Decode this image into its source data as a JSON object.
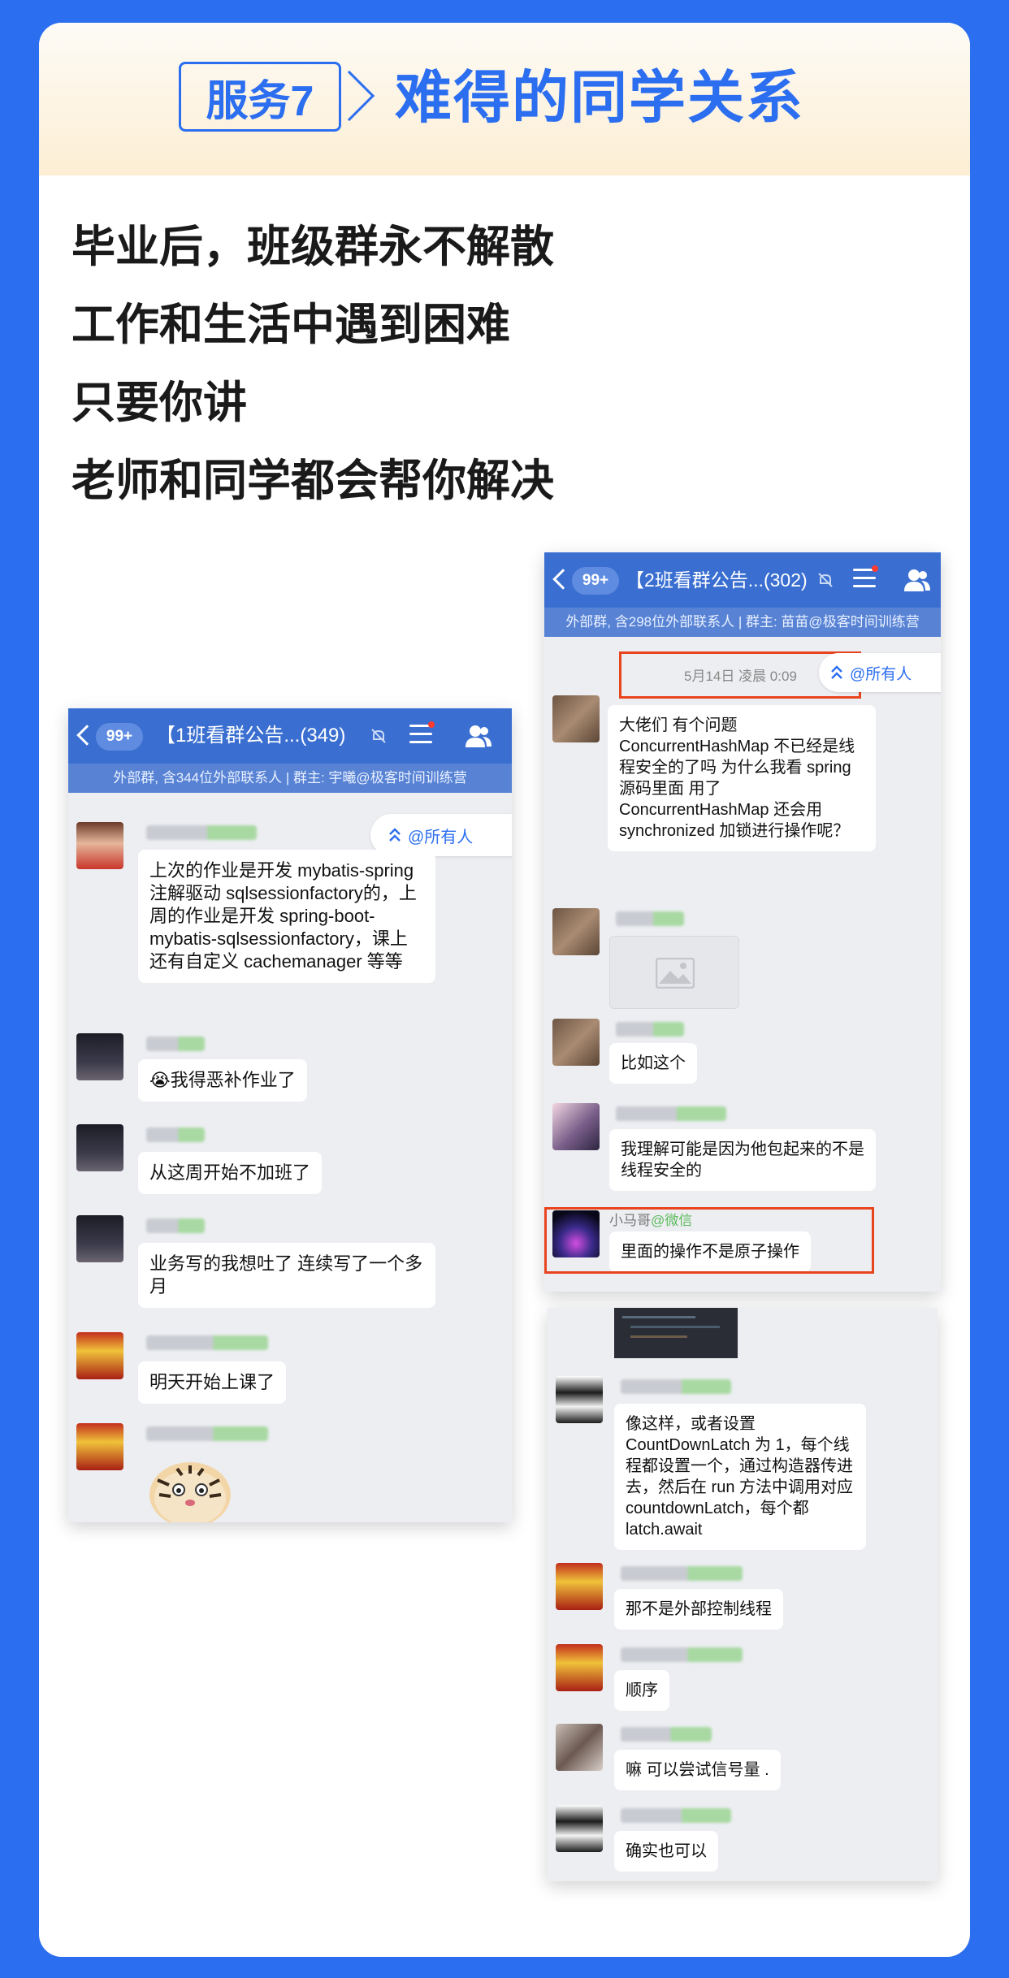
{
  "header": {
    "tag": "服务7",
    "title": "难得的同学关系"
  },
  "intro": [
    "毕业后，班级群永不解散",
    "工作和生活中遇到困难",
    "只要你讲",
    "老师和同学都会帮你解决"
  ],
  "chat1": {
    "badge": "99+",
    "title": "【1班看群公告...(349)",
    "subtitle": "外部群, 含344位外部联系人 | 群主: 宇曦@极客时间训练营",
    "at_all": "@所有人",
    "messages": [
      "上次的作业是开发 mybatis-spring 注解驱动 sqlsessionfactory的，上周的作业是开发 spring-boot-mybatis-sqlsessionfactory，课上还有自定义 cachemanager 等等",
      "😭我得恶补作业了",
      "从这周开始不加班了",
      "业务写的我想吐了 连续写了一个多月",
      "明天开始上课了"
    ]
  },
  "chat2": {
    "badge": "99+",
    "title": "【2班看群公告...(302)",
    "subtitle": "外部群, 含298位外部联系人 | 群主: 苗苗@极客时间训练营",
    "time": "5月14日 凌晨 0:09",
    "at_all": "@所有人",
    "messages": [
      "大佬们 有个问题 ConcurrentHashMap 不已经是线程安全的了吗 为什么我看 spring 源码里面 用了 ConcurrentHashMap 还会用 synchronized 加锁进行操作呢？",
      "比如这个",
      "我理解可能是因为他包起来的不是线程安全的",
      "里面的操作不是原子操作"
    ],
    "highlight_name": "小马哥",
    "highlight_suffix": "@微信"
  },
  "chat3": {
    "messages": [
      "像这样，或者设置 CountDownLatch 为 1，每个线程都设置一个，通过构造器传进去，然后在 run 方法中调用对应 countdownLatch，每个都 latch.await",
      "那不是外部控制线程",
      "顺序",
      "嘛 可以尝试信号量 .",
      "确实也可以"
    ]
  },
  "colors": {
    "brand_blue": "#2b6ef0",
    "chat_header": "#3a6fd1",
    "highlight_red": "#e8441e"
  }
}
